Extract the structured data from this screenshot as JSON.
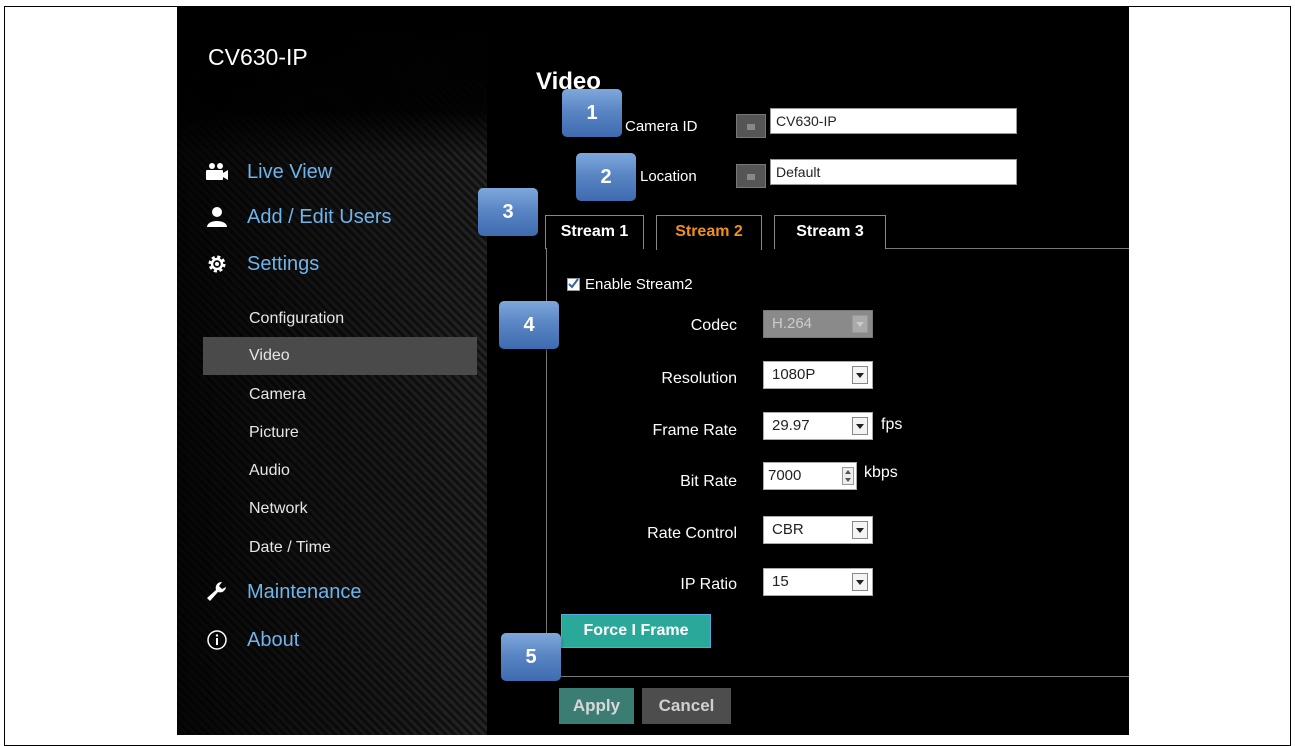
{
  "sidebar": {
    "brand": "CV630-IP",
    "main_items": [
      {
        "label": "Live View",
        "icon": "camera-icon"
      },
      {
        "label": "Add / Edit Users",
        "icon": "user-icon"
      },
      {
        "label": "Settings",
        "icon": "gear-icon"
      },
      {
        "label": "Maintenance",
        "icon": "wrench-icon"
      },
      {
        "label": "About",
        "icon": "info-icon"
      }
    ],
    "sub_items": [
      {
        "label": "Configuration"
      },
      {
        "label": "Video",
        "active": true
      },
      {
        "label": "Camera"
      },
      {
        "label": "Picture"
      },
      {
        "label": "Audio"
      },
      {
        "label": "Network"
      },
      {
        "label": "Date / Time"
      }
    ]
  },
  "page": {
    "title": "Video",
    "camera_id_label": "Camera ID",
    "camera_id_value": "CV630-IP",
    "location_label": "Location",
    "location_value": "Default"
  },
  "tabs": [
    {
      "label": "Stream 1"
    },
    {
      "label": "Stream 2",
      "active": true
    },
    {
      "label": "Stream 3"
    }
  ],
  "stream": {
    "enable_label": "Enable Stream2",
    "enabled": true,
    "codec_label": "Codec",
    "codec_value": "H.264",
    "resolution_label": "Resolution",
    "resolution_value": "1080P",
    "frame_rate_label": "Frame Rate",
    "frame_rate_value": "29.97",
    "frame_rate_unit": "fps",
    "bit_rate_label": "Bit Rate",
    "bit_rate_value": "7000",
    "bit_rate_unit": "kbps",
    "rate_control_label": "Rate Control",
    "rate_control_value": "CBR",
    "ip_ratio_label": "IP Ratio",
    "ip_ratio_value": "15",
    "force_iframe_label": "Force I Frame"
  },
  "actions": {
    "apply_label": "Apply",
    "cancel_label": "Cancel"
  },
  "callouts": [
    "1",
    "2",
    "3",
    "4",
    "5"
  ],
  "colors": {
    "link_blue": "#6fb4ea",
    "active_tab": "#f0901e",
    "teal_button": "#2aa99a",
    "callout_blue": "#5a86c4"
  }
}
